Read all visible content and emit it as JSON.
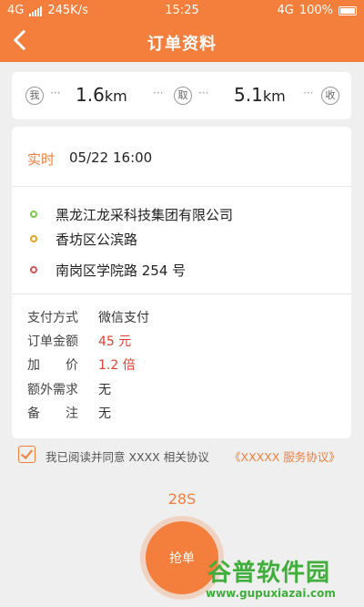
{
  "status_bar": {
    "network_left": "4G",
    "speed": "245K/s",
    "time": "15:25",
    "network_right": "4G",
    "battery": "100%"
  },
  "nav": {
    "title": "订单资料"
  },
  "route": {
    "start_pin": "我",
    "pickup_pin": "取",
    "dest_pin": "收",
    "pickup_distance": "1.6",
    "delivery_distance": "5.1",
    "unit": "km",
    "dots": "···"
  },
  "order": {
    "time_type": "实时",
    "time": "05/22  16:00",
    "addresses": [
      {
        "text": "黑龙江龙采科技集团有限公司",
        "color": "#7ac943"
      },
      {
        "text": "香坊区公滨路",
        "color": "#f0a020"
      },
      {
        "text": "南岗区学院路 254 号",
        "color": "#d9534f"
      }
    ],
    "details": [
      {
        "label": "支付方式",
        "value": "微信支付",
        "highlight": false
      },
      {
        "label": "订单金额",
        "value": "45 元",
        "highlight": true
      },
      {
        "label": "加　　价",
        "value": "1.2 倍",
        "highlight": true
      },
      {
        "label": "额外需求",
        "value": "无",
        "highlight": false
      },
      {
        "label": "备　　注",
        "value": "无",
        "highlight": false
      }
    ]
  },
  "agreement": {
    "checked": true,
    "text": "我已阅读并同意 XXXX 相关协议",
    "link": "《XXXXX 服务协议》"
  },
  "countdown": "28S",
  "grab_button": "抢单",
  "watermark": {
    "name": "谷普软件园",
    "url": "www.gupuxiazai.com"
  },
  "colors": {
    "accent": "#f47e3b",
    "price": "#e53e2e"
  }
}
